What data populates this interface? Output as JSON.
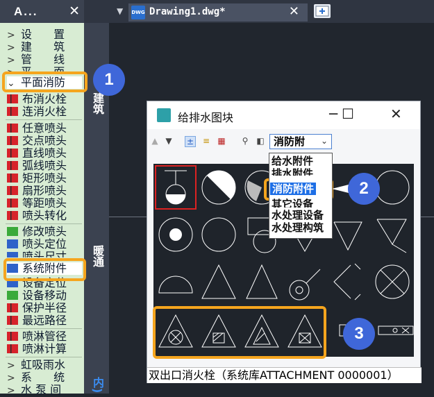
{
  "top": {
    "palette_title": "A...",
    "close": "✕",
    "collapse": "▼",
    "tab_title": "Drawing1.dwg*",
    "tab_close": "✕",
    "dwg_icon": "DWG"
  },
  "palette": {
    "items": [
      {
        "label": "设 置",
        "chevron": ">"
      },
      {
        "label": "建 筑",
        "chevron": ">"
      },
      {
        "label": "管 线",
        "chevron": ">"
      },
      {
        "label": "平 面",
        "chevron": ">"
      },
      {
        "label": "平面消防",
        "chevron": "⌄"
      },
      {
        "label": "布消火栓"
      },
      {
        "label": "连消火栓"
      },
      {
        "label": "任意喷头"
      },
      {
        "label": "交点喷头"
      },
      {
        "label": "直线喷头"
      },
      {
        "label": "弧线喷头"
      },
      {
        "label": "矩形喷头"
      },
      {
        "label": "扇形喷头"
      },
      {
        "label": "等距喷头"
      },
      {
        "label": "喷头转化"
      },
      {
        "label": "修改喷头"
      },
      {
        "label": "喷头定位"
      },
      {
        "label": "喷头尺寸"
      },
      {
        "label": "系统附件"
      },
      {
        "label": "设备定位"
      },
      {
        "label": "设备移动"
      },
      {
        "label": "保护半径"
      },
      {
        "label": "最远路径"
      },
      {
        "label": "喷淋管径"
      },
      {
        "label": "喷淋计算"
      },
      {
        "label": "虹吸雨水",
        "chevron": ">"
      },
      {
        "label": "系 统",
        "chevron": ">"
      },
      {
        "label": "水 泵 间",
        "chevron": ">"
      }
    ],
    "vtabs": [
      "建筑",
      "暖通",
      "内)"
    ]
  },
  "dialog": {
    "title": "给排水图块",
    "minimize": "─",
    "maximize": "☐",
    "close": "✕",
    "combo_value": "消防附",
    "combo_arrow": "⌄",
    "dropdown": [
      "给水附件",
      "排水附件",
      "消防附件",
      "其它设备",
      "水处理设备",
      "水处理构筑"
    ],
    "dropdown_selected": "消防附件",
    "status": "双出口消火栓（系统库ATTACHMENT 0000001）"
  },
  "callouts": [
    "1",
    "2",
    "3"
  ],
  "colors": {
    "highlight": "#f5a51e",
    "badge": "#3f67d9",
    "palette_bg": "#d8ecd3",
    "canvas_bg": "#21262e"
  }
}
